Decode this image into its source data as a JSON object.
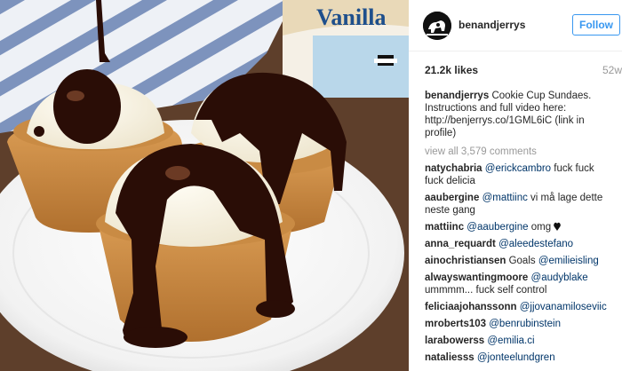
{
  "post": {
    "username": "benandjerrys",
    "follow_label": "Follow",
    "likes": "21.2k likes",
    "age": "52w",
    "caption": {
      "username": "benandjerrys",
      "text": "Cookie Cup Sundaes. Instructions and full video here: http://benjerrys.co/1GML6iC (link in profile)"
    },
    "view_all_comments": "view all 3,579 comments",
    "comments": [
      {
        "user": "natychabria",
        "mention": "@erickcambro",
        "text": " fuck fuck fuck delicia"
      },
      {
        "user": "aaubergine",
        "mention": "@mattiinc",
        "text": " vi må lage dette neste gang"
      },
      {
        "user": "mattiinc",
        "mention": "@aaubergine",
        "text": " omg"
      },
      {
        "user": "anna_requardt",
        "mention": "@aleedestefano",
        "text": ""
      },
      {
        "user": "ainochristiansen",
        "mention": "",
        "text": "Goals ",
        "mention2": "@emilieisling"
      },
      {
        "user": "alwayswantingmoore",
        "mention": "@audyblake",
        "text": " ummmm... fuck self control"
      },
      {
        "user": "feliciaajohanssonn",
        "mention": "@jjovanamiloseviic",
        "text": ""
      },
      {
        "user": "mroberts103",
        "mention": "@benrubinstein",
        "text": ""
      },
      {
        "user": "larabowerss",
        "mention": "@emilia.ci",
        "text": ""
      },
      {
        "user": "nataliesss",
        "mention": "@jonteelundgren",
        "text": ""
      }
    ]
  },
  "photo": {
    "pint_label": "Vanilla"
  },
  "colors": {
    "follow_blue": "#3897f0",
    "mention_blue": "#003569",
    "muted_gray": "#999999",
    "chocolate": "#2a0d06"
  },
  "icons": {
    "avatar": "cow-logo-icon",
    "heart": "black-heart-icon"
  }
}
